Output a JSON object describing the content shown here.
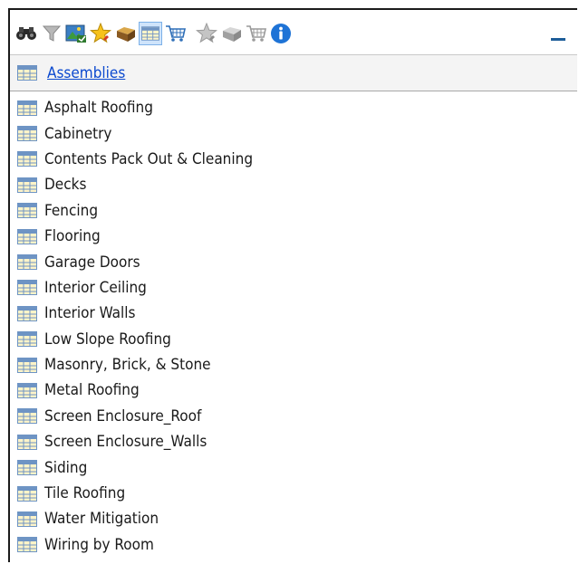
{
  "toolbar": {
    "icons": [
      {
        "name": "binoculars-icon"
      },
      {
        "name": "filter-icon"
      },
      {
        "name": "picture-icon"
      },
      {
        "name": "star-favorite-icon"
      },
      {
        "name": "puzzle-box-icon"
      },
      {
        "name": "table-icon",
        "active": true
      },
      {
        "name": "cart-icon"
      },
      {
        "name": "star-disabled-icon"
      },
      {
        "name": "puzzle-disabled-icon"
      },
      {
        "name": "cart-disabled-icon"
      },
      {
        "name": "info-icon"
      }
    ],
    "colors": {
      "info": "#1e73d6",
      "active_bg": "#cfe4fb",
      "link": "#0b49cf"
    }
  },
  "breadcrumb": {
    "label": "Assemblies"
  },
  "items": [
    "Asphalt Roofing",
    "Cabinetry",
    "Contents Pack Out & Cleaning",
    "Decks",
    "Fencing",
    "Flooring",
    "Garage Doors",
    "Interior Ceiling",
    "Interior Walls",
    "Low Slope Roofing",
    "Masonry, Brick, & Stone",
    "Metal Roofing",
    "Screen Enclosure_Roof",
    "Screen Enclosure_Walls",
    "Siding",
    "Tile Roofing",
    "Water Mitigation",
    "Wiring by Room"
  ]
}
